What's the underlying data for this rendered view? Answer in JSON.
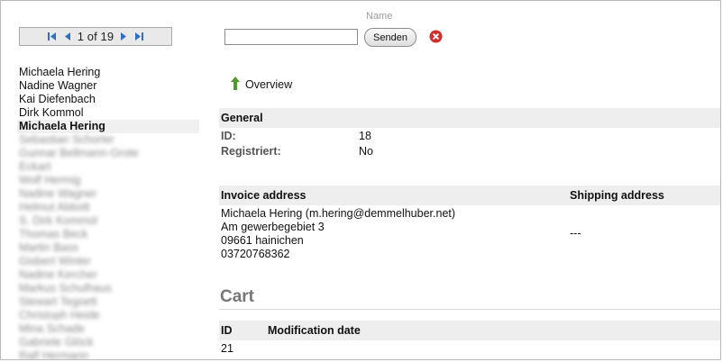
{
  "pager": {
    "text": "1 of 19"
  },
  "people": [
    {
      "name": "Michaela Hering",
      "state": "normal"
    },
    {
      "name": "Nadine Wagner",
      "state": "normal"
    },
    {
      "name": "Kai Diefenbach",
      "state": "normal"
    },
    {
      "name": "Dirk Kommol",
      "state": "normal"
    },
    {
      "name": "Michaela Hering",
      "state": "active"
    },
    {
      "name": "Sebastian Schorler",
      "state": "blurred"
    },
    {
      "name": "Gunnar Bellmann-Grote",
      "state": "blurred"
    },
    {
      "name": "Eckart",
      "state": "blurred"
    },
    {
      "name": "Wolf Hermig",
      "state": "blurred"
    },
    {
      "name": "Nadine Wagner",
      "state": "blurred"
    },
    {
      "name": "Helmut Abbott",
      "state": "blurred"
    },
    {
      "name": "S. Dirk Kommol",
      "state": "blurred"
    },
    {
      "name": "Thomas Beck",
      "state": "blurred"
    },
    {
      "name": "Martin Bass",
      "state": "blurred"
    },
    {
      "name": "Gisbert Winter",
      "state": "blurred"
    },
    {
      "name": "Nadine Kercher",
      "state": "blurred"
    },
    {
      "name": "Markus Schulhaus",
      "state": "blurred"
    },
    {
      "name": "Stewart Tegoett",
      "state": "blurred"
    },
    {
      "name": "Christoph Heide",
      "state": "blurred"
    },
    {
      "name": "Mina Schade",
      "state": "blurred"
    },
    {
      "name": "Gabriele Glöck",
      "state": "blurred"
    },
    {
      "name": "Ralf Hermann",
      "state": "blurred"
    }
  ],
  "search": {
    "label": "Name",
    "value": "",
    "placeholder": "",
    "button": "Senden"
  },
  "overview": {
    "label": "Overview"
  },
  "general": {
    "title": "General",
    "id_label": "ID:",
    "id_value": "18",
    "reg_label": "Registriert:",
    "reg_value": "No"
  },
  "address": {
    "invoice_title": "Invoice address",
    "shipping_title": "Shipping address",
    "invoice_lines": [
      "Michaela Hering (m.hering@demmelhuber.net)",
      "Am gewerbegebiet 3",
      "09661 hainichen",
      "03720768362"
    ],
    "shipping_value": "---"
  },
  "cart": {
    "title": "Cart",
    "col_id": "ID",
    "col_date": "Modification date",
    "row_id": "21",
    "row_date": ""
  },
  "colors": {
    "section_bg": "#eeeeee",
    "active_bg": "#f0f0f0",
    "clear_icon": "#d62b2b",
    "arrow_green": "#4e9a2f"
  }
}
